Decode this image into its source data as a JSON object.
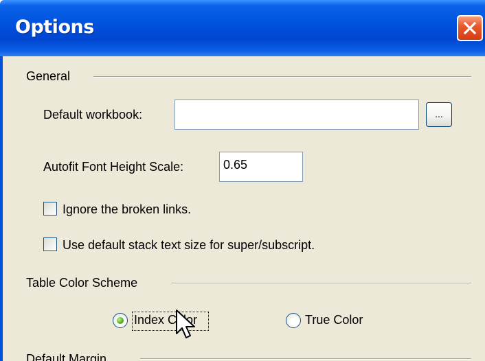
{
  "dialog": {
    "title": "Options",
    "close_icon": "close-icon"
  },
  "general": {
    "heading": "General",
    "default_workbook_label": "Default workbook:",
    "default_workbook_value": "",
    "browse_label": "...",
    "autofit_label": "Autofit Font Height Scale:",
    "autofit_value": "0.65",
    "ignore_broken_links_label": "Ignore the broken links.",
    "ignore_broken_links_checked": false,
    "default_stack_text_label": "Use default stack text size for super/subscript.",
    "default_stack_text_checked": false
  },
  "table_color_scheme": {
    "heading": "Table Color Scheme",
    "options": [
      {
        "label": "Index Color",
        "selected": true
      },
      {
        "label": "True Color",
        "selected": false
      }
    ]
  },
  "default_margin": {
    "heading": "Default Margin"
  },
  "colors": {
    "titlebar": "#0050dc",
    "dialog_bg": "#ece9d8",
    "close_button": "#e95a2e",
    "radio_selected": "#4aae22"
  }
}
